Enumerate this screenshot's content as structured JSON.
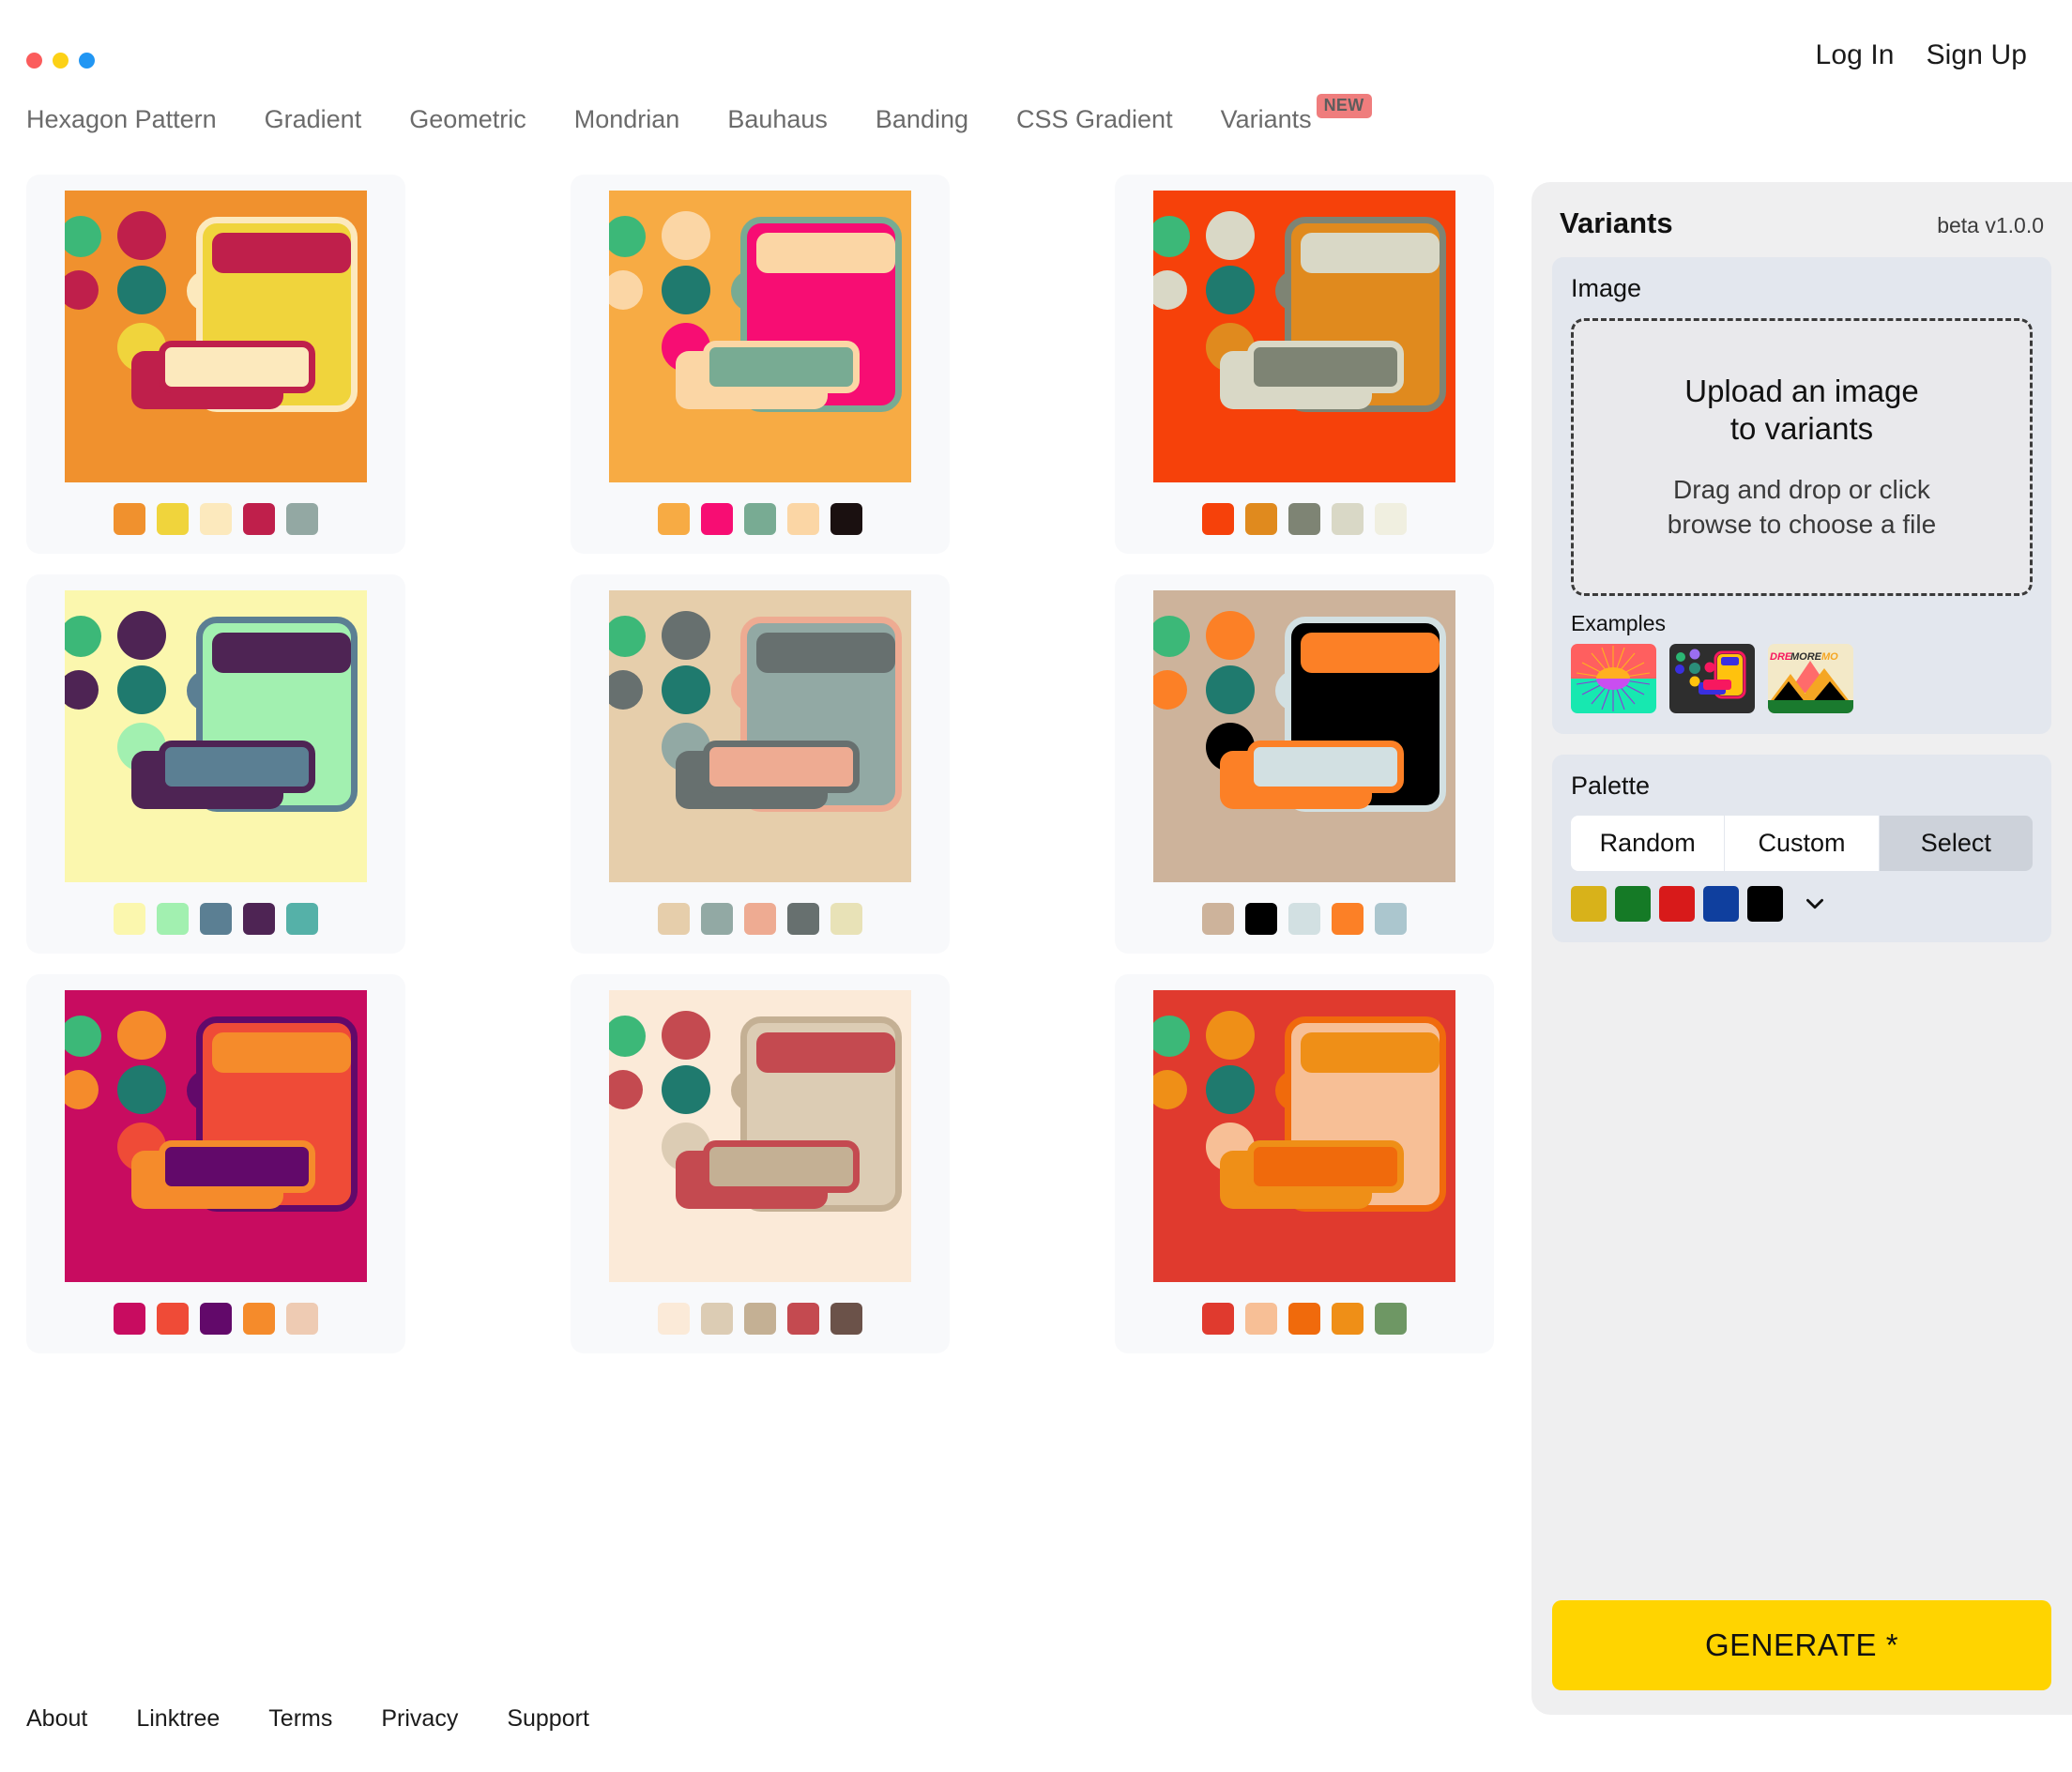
{
  "window": {
    "dots": [
      "red",
      "yellow",
      "blue"
    ]
  },
  "auth": {
    "login": "Log In",
    "signup": "Sign Up"
  },
  "nav": {
    "items": [
      {
        "label": "Hexagon Pattern"
      },
      {
        "label": "Gradient"
      },
      {
        "label": "Geometric"
      },
      {
        "label": "Mondrian"
      },
      {
        "label": "Bauhaus"
      },
      {
        "label": "Banding"
      },
      {
        "label": "CSS Gradient"
      },
      {
        "label": "Variants",
        "badge": "NEW"
      }
    ]
  },
  "footer": {
    "links": [
      "About",
      "Linktree",
      "Terms",
      "Privacy",
      "Support"
    ]
  },
  "sidebar": {
    "title": "Variants",
    "version": "beta v1.0.0",
    "image_label": "Image",
    "dropzone": {
      "main_line1": "Upload an image",
      "main_line2": "to variants",
      "sub_line1": "Drag and drop or click",
      "sub_line2": "browse to choose a file"
    },
    "examples_label": "Examples",
    "examples": [
      {
        "name": "sunburst-example"
      },
      {
        "name": "blocks-example",
        "text": ""
      },
      {
        "name": "mountains-example",
        "text": "DREMOREMO"
      }
    ],
    "palette_label": "Palette",
    "palette_modes": [
      {
        "label": "Random",
        "active": false
      },
      {
        "label": "Custom",
        "active": false
      },
      {
        "label": "Select",
        "active": true
      }
    ],
    "palette_colors": [
      "#d8b21a",
      "#157a26",
      "#d81a1a",
      "#0f3f9e",
      "#000000"
    ],
    "chevron": "chevron-down-icon",
    "generate_label": "GENERATE *",
    "generate_color": "#ffd400"
  },
  "cards": [
    {
      "name": "variant-card-1",
      "bg": "#f0912e",
      "panel_bg": "#f0d43c",
      "panel_border": "#fce9bd",
      "panel_head": "#bf1f4b",
      "bar_back": "#bf1f4b",
      "bar_front": "#fce9bd",
      "bar_front_border": "#bf1f4b",
      "dots": [
        "#3cb878",
        "#bf1f4b",
        "#bf1f4b",
        "#1f7a6e",
        "#fce9bd",
        "#f0d43c"
      ],
      "swatches": [
        "#f0912e",
        "#f0d43c",
        "#fce9bd",
        "#bf1f4b",
        "#93a8a3"
      ]
    },
    {
      "name": "variant-card-2",
      "bg": "#f7ab44",
      "panel_bg": "#f70d73",
      "panel_border": "#78ab93",
      "panel_head": "#fbd6a5",
      "bar_back": "#fbd6a5",
      "bar_front": "#78ab93",
      "bar_front_border": "#fbd6a5",
      "dots": [
        "#3cb878",
        "#fbd6a5",
        "#fbd6a5",
        "#1f7a6e",
        "#78ab93",
        "#f70d73"
      ],
      "swatches": [
        "#f7ab44",
        "#f70d73",
        "#78ab93",
        "#fbd6a5",
        "#1a1010"
      ]
    },
    {
      "name": "variant-card-3",
      "bg": "#f6410a",
      "panel_bg": "#e08a1e",
      "panel_border": "#7e8474",
      "panel_head": "#d9d8c6",
      "bar_back": "#d9d8c6",
      "bar_front": "#7e8474",
      "bar_front_border": "#d9d8c6",
      "dots": [
        "#3cb878",
        "#d9d8c6",
        "#d9d8c6",
        "#1f7a6e",
        "#7e8474",
        "#e08a1e"
      ],
      "swatches": [
        "#f6410a",
        "#e08a1e",
        "#7e8474",
        "#d9d8c6",
        "#f0efe0"
      ]
    },
    {
      "name": "variant-card-4",
      "bg": "#fbf7ae",
      "panel_bg": "#a2f0b0",
      "panel_border": "#5b7f93",
      "panel_head": "#4e2454",
      "bar_back": "#4e2454",
      "bar_front": "#5b7f93",
      "bar_front_border": "#4e2454",
      "dots": [
        "#3cb878",
        "#4e2454",
        "#4e2454",
        "#1f7a6e",
        "#5b7f93",
        "#a2f0b0"
      ],
      "swatches": [
        "#fbf7ae",
        "#a2f0b0",
        "#5b7f93",
        "#4e2454",
        "#55b1a8"
      ]
    },
    {
      "name": "variant-card-5",
      "bg": "#e6ceab",
      "panel_bg": "#92a9a4",
      "panel_border": "#eeab92",
      "panel_head": "#67706f",
      "bar_back": "#67706f",
      "bar_front": "#eeab92",
      "bar_front_border": "#67706f",
      "dots": [
        "#3cb878",
        "#67706f",
        "#67706f",
        "#1f7a6e",
        "#eeab92",
        "#92a9a4"
      ],
      "swatches": [
        "#e6ceab",
        "#92a9a4",
        "#eeab92",
        "#67706f",
        "#e8e2b7"
      ]
    },
    {
      "name": "variant-card-6",
      "bg": "#cdb39b",
      "panel_bg": "#000000",
      "panel_border": "#d2e0e2",
      "panel_head": "#fc8026",
      "bar_back": "#fc8026",
      "bar_front": "#d2e0e2",
      "bar_front_border": "#fc8026",
      "dots": [
        "#3cb878",
        "#fc8026",
        "#fc8026",
        "#1f7a6e",
        "#d2e0e2",
        "#000000"
      ],
      "swatches": [
        "#cdb39b",
        "#000000",
        "#d2e0e2",
        "#fc8026",
        "#abc6ce"
      ]
    },
    {
      "name": "variant-card-7",
      "bg": "#c80c60",
      "panel_bg": "#ef4b37",
      "panel_border": "#62096a",
      "panel_head": "#f58b2b",
      "bar_back": "#f58b2b",
      "bar_front": "#62096a",
      "bar_front_border": "#f58b2b",
      "dots": [
        "#3cb878",
        "#f58b2b",
        "#f58b2b",
        "#1f7a6e",
        "#62096a",
        "#ef4b37"
      ],
      "swatches": [
        "#c80c60",
        "#ef4b37",
        "#62096a",
        "#f58b2b",
        "#eecbb3"
      ]
    },
    {
      "name": "variant-card-8",
      "bg": "#fbead8",
      "panel_bg": "#dcccb4",
      "panel_border": "#c4b094",
      "panel_head": "#c44a50",
      "bar_back": "#c44a50",
      "bar_front": "#c4b094",
      "bar_front_border": "#c44a50",
      "dots": [
        "#3cb878",
        "#c44a50",
        "#c44a50",
        "#1f7a6e",
        "#c4b094",
        "#dcccb4"
      ],
      "swatches": [
        "#fbead8",
        "#dcccb4",
        "#c4b094",
        "#c44a50",
        "#6b5249"
      ]
    },
    {
      "name": "variant-card-9",
      "bg": "#e03a2e",
      "panel_bg": "#f7bf96",
      "panel_border": "#f06a0c",
      "panel_head": "#ef8f17",
      "bar_back": "#ef8f17",
      "bar_front": "#f06a0c",
      "bar_front_border": "#ef8f17",
      "dots": [
        "#3cb878",
        "#ef8f17",
        "#ef8f17",
        "#1f7a6e",
        "#f06a0c",
        "#f7bf96"
      ],
      "swatches": [
        "#e03a2e",
        "#f7bf96",
        "#f06a0c",
        "#ef8f17",
        "#6e9764"
      ]
    }
  ]
}
